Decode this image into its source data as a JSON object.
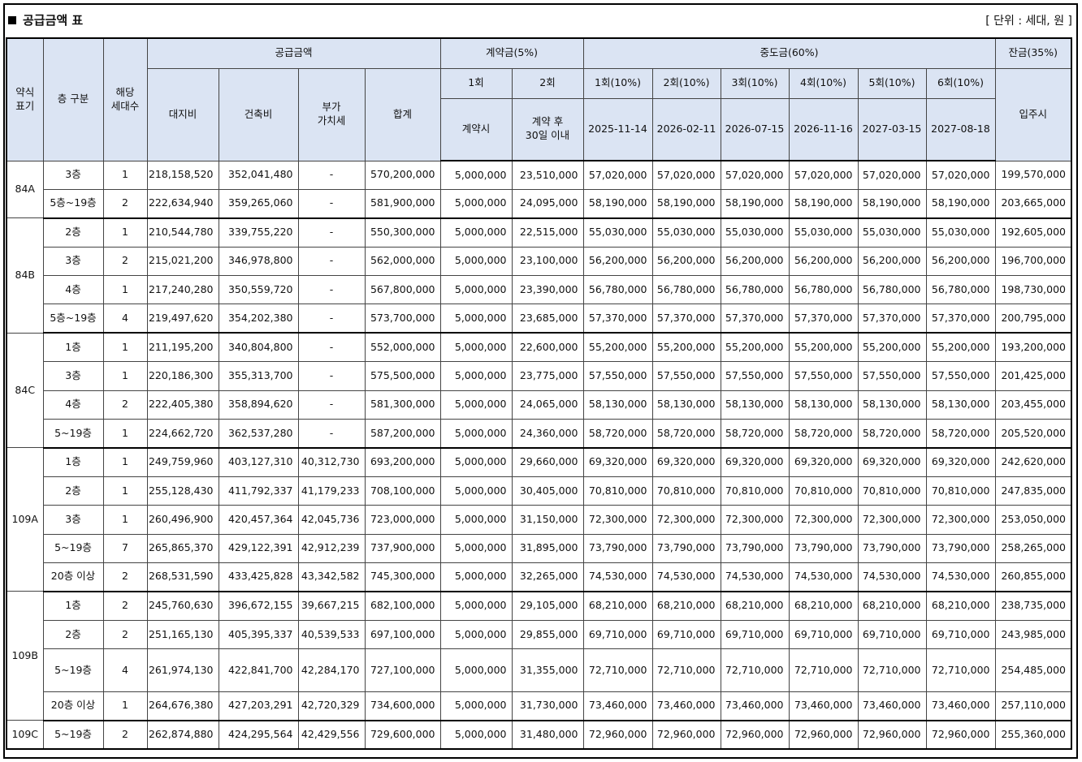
{
  "title": "공급금액 표",
  "unit": "[ 단위 : 세대, 원 ]",
  "headers": {
    "type": "약식\n표기",
    "floor": "층 구분",
    "units": "해당\n세대수",
    "supply": "공급금액",
    "land": "대지비",
    "building": "건축비",
    "vat": "부가\n가치세",
    "total": "합계",
    "deposit": "계약금(5%)",
    "dep1": "1회",
    "dep2": "2회",
    "dep1_when": "계약시",
    "dep2_when": "계약 후\n30일 이내",
    "middle": "중도금(60%)",
    "mid_rounds": [
      "1회(10%)",
      "2회(10%)",
      "3회(10%)",
      "4회(10%)",
      "5회(10%)",
      "6회(10%)"
    ],
    "mid_dates": [
      "2025-11-14",
      "2026-02-11",
      "2026-07-15",
      "2026-11-16",
      "2027-03-15",
      "2027-08-18"
    ],
    "balance": "잔금(35%)",
    "balance_when": "입주시"
  },
  "groups": [
    {
      "type": "84A",
      "rows": [
        {
          "floor": "3층",
          "units": "1",
          "land": "218,158,520",
          "building": "352,041,480",
          "vat": "-",
          "total": "570,200,000",
          "dep1": "5,000,000",
          "dep2": "23,510,000",
          "mid": "57,020,000",
          "balance": "199,570,000"
        },
        {
          "floor": "5층~19층",
          "units": "2",
          "land": "222,634,940",
          "building": "359,265,060",
          "vat": "-",
          "total": "581,900,000",
          "dep1": "5,000,000",
          "dep2": "24,095,000",
          "mid": "58,190,000",
          "balance": "203,665,000"
        }
      ]
    },
    {
      "type": "84B",
      "rows": [
        {
          "floor": "2층",
          "units": "1",
          "land": "210,544,780",
          "building": "339,755,220",
          "vat": "-",
          "total": "550,300,000",
          "dep1": "5,000,000",
          "dep2": "22,515,000",
          "mid": "55,030,000",
          "balance": "192,605,000"
        },
        {
          "floor": "3층",
          "units": "2",
          "land": "215,021,200",
          "building": "346,978,800",
          "vat": "-",
          "total": "562,000,000",
          "dep1": "5,000,000",
          "dep2": "23,100,000",
          "mid": "56,200,000",
          "balance": "196,700,000"
        },
        {
          "floor": "4층",
          "units": "1",
          "land": "217,240,280",
          "building": "350,559,720",
          "vat": "-",
          "total": "567,800,000",
          "dep1": "5,000,000",
          "dep2": "23,390,000",
          "mid": "56,780,000",
          "balance": "198,730,000"
        },
        {
          "floor": "5층~19층",
          "units": "4",
          "land": "219,497,620",
          "building": "354,202,380",
          "vat": "-",
          "total": "573,700,000",
          "dep1": "5,000,000",
          "dep2": "23,685,000",
          "mid": "57,370,000",
          "balance": "200,795,000"
        }
      ]
    },
    {
      "type": "84C",
      "rows": [
        {
          "floor": "1층",
          "units": "1",
          "land": "211,195,200",
          "building": "340,804,800",
          "vat": "-",
          "total": "552,000,000",
          "dep1": "5,000,000",
          "dep2": "22,600,000",
          "mid": "55,200,000",
          "balance": "193,200,000"
        },
        {
          "floor": "3층",
          "units": "1",
          "land": "220,186,300",
          "building": "355,313,700",
          "vat": "-",
          "total": "575,500,000",
          "dep1": "5,000,000",
          "dep2": "23,775,000",
          "mid": "57,550,000",
          "balance": "201,425,000"
        },
        {
          "floor": "4층",
          "units": "2",
          "land": "222,405,380",
          "building": "358,894,620",
          "vat": "-",
          "total": "581,300,000",
          "dep1": "5,000,000",
          "dep2": "24,065,000",
          "mid": "58,130,000",
          "balance": "203,455,000"
        },
        {
          "floor": "5~19층",
          "units": "1",
          "land": "224,662,720",
          "building": "362,537,280",
          "vat": "-",
          "total": "587,200,000",
          "dep1": "5,000,000",
          "dep2": "24,360,000",
          "mid": "58,720,000",
          "balance": "205,520,000"
        }
      ]
    },
    {
      "type": "109A",
      "rows": [
        {
          "floor": "1층",
          "units": "1",
          "land": "249,759,960",
          "building": "403,127,310",
          "vat": "40,312,730",
          "total": "693,200,000",
          "dep1": "5,000,000",
          "dep2": "29,660,000",
          "mid": "69,320,000",
          "balance": "242,620,000"
        },
        {
          "floor": "2층",
          "units": "1",
          "land": "255,128,430",
          "building": "411,792,337",
          "vat": "41,179,233",
          "total": "708,100,000",
          "dep1": "5,000,000",
          "dep2": "30,405,000",
          "mid": "70,810,000",
          "balance": "247,835,000"
        },
        {
          "floor": "3층",
          "units": "1",
          "land": "260,496,900",
          "building": "420,457,364",
          "vat": "42,045,736",
          "total": "723,000,000",
          "dep1": "5,000,000",
          "dep2": "31,150,000",
          "mid": "72,300,000",
          "balance": "253,050,000"
        },
        {
          "floor": "5~19층",
          "units": "7",
          "land": "265,865,370",
          "building": "429,122,391",
          "vat": "42,912,239",
          "total": "737,900,000",
          "dep1": "5,000,000",
          "dep2": "31,895,000",
          "mid": "73,790,000",
          "balance": "258,265,000"
        },
        {
          "floor": "20층 이상",
          "units": "2",
          "land": "268,531,590",
          "building": "433,425,828",
          "vat": "43,342,582",
          "total": "745,300,000",
          "dep1": "5,000,000",
          "dep2": "32,265,000",
          "mid": "74,530,000",
          "balance": "260,855,000"
        }
      ]
    },
    {
      "type": "109B",
      "rows": [
        {
          "floor": "1층",
          "units": "2",
          "land": "245,760,630",
          "building": "396,672,155",
          "vat": "39,667,215",
          "total": "682,100,000",
          "dep1": "5,000,000",
          "dep2": "29,105,000",
          "mid": "68,210,000",
          "balance": "238,735,000"
        },
        {
          "floor": "2층",
          "units": "2",
          "land": "251,165,130",
          "building": "405,395,337",
          "vat": "40,539,533",
          "total": "697,100,000",
          "dep1": "5,000,000",
          "dep2": "29,855,000",
          "mid": "69,710,000",
          "balance": "243,985,000"
        },
        {
          "floor": "5~19층",
          "units": "4",
          "land": "261,974,130",
          "building": "422,841,700",
          "vat": "42,284,170",
          "total": "727,100,000",
          "dep1": "5,000,000",
          "dep2": "31,355,000",
          "mid": "72,710,000",
          "balance": "254,485,000"
        },
        {
          "floor": "20층 이상",
          "units": "1",
          "land": "264,676,380",
          "building": "427,203,291",
          "vat": "42,720,329",
          "total": "734,600,000",
          "dep1": "5,000,000",
          "dep2": "31,730,000",
          "mid": "73,460,000",
          "balance": "257,110,000"
        }
      ]
    },
    {
      "type": "109C",
      "rows": [
        {
          "floor": "5~19층",
          "units": "2",
          "land": "262,874,880",
          "building": "424,295,564",
          "vat": "42,429,556",
          "total": "729,600,000",
          "dep1": "5,000,000",
          "dep2": "31,480,000",
          "mid": "72,960,000",
          "balance": "255,360,000"
        }
      ]
    }
  ]
}
